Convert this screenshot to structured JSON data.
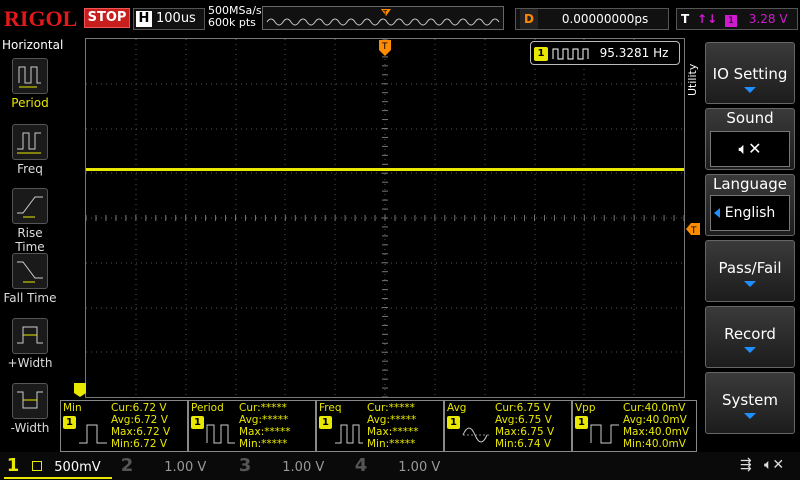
{
  "brand": "RIGOL",
  "run_state": "STOP",
  "horizontal": {
    "key": "H",
    "timebase": "100us"
  },
  "acquisition": {
    "sample_rate": "500MSa/s",
    "memory_depth": "600k pts"
  },
  "delay": {
    "key": "D",
    "value": "0.00000000ps"
  },
  "trigger": {
    "key": "T",
    "channel": "1",
    "level": "3.28 V"
  },
  "left_menu": {
    "title": "Horizontal",
    "items": [
      {
        "label": "Period"
      },
      {
        "label": "Freq"
      },
      {
        "label": "Rise Time"
      },
      {
        "label": "Fall Time"
      },
      {
        "label": "+Width"
      },
      {
        "label": "-Width"
      }
    ]
  },
  "freq_badge": {
    "channel": "1",
    "value": "95.3281 Hz"
  },
  "utility_label": "Utility",
  "right_menu": [
    {
      "label": "IO Setting"
    },
    {
      "label": "Sound"
    },
    {
      "label": "Language",
      "value": "English"
    },
    {
      "label": "Pass/Fail"
    },
    {
      "label": "Record"
    },
    {
      "label": "System"
    }
  ],
  "measurements": [
    {
      "name": "Min",
      "channel": "1",
      "cur": "Cur:6.72 V",
      "avg": "Avg:6.72 V",
      "max": "Max:6.72 V",
      "min": "Min:6.72 V"
    },
    {
      "name": "Period",
      "channel": "1",
      "cur": "Cur:*****",
      "avg": "Avg:*****",
      "max": "Max:*****",
      "min": "Min:*****"
    },
    {
      "name": "Freq",
      "channel": "1",
      "cur": "Cur:*****",
      "avg": "Avg:*****",
      "max": "Max:*****",
      "min": "Min:*****"
    },
    {
      "name": "Avg",
      "channel": "1",
      "cur": "Cur:6.75 V",
      "avg": "Avg:6.75 V",
      "max": "Max:6.75 V",
      "min": "Min:6.74 V"
    },
    {
      "name": "Vpp",
      "channel": "1",
      "cur": "Cur:40.0mV",
      "avg": "Avg:40.0mV",
      "max": "Max:40.0mV",
      "min": "Min:40.0mV"
    }
  ],
  "channels": [
    {
      "num": "1",
      "scale": "500mV",
      "color": "#e8e800"
    },
    {
      "num": "2",
      "scale": "1.00 V",
      "color": "#00bcd4"
    },
    {
      "num": "3",
      "scale": "1.00 V",
      "color": "#d01ad0"
    },
    {
      "num": "4",
      "scale": "1.00 V",
      "color": "#1e6fff"
    }
  ],
  "colors": {
    "ch1": "#e8e800",
    "trigger": "#ff8c00",
    "accent": "#1e90ff",
    "brand": "#e01a1a"
  }
}
